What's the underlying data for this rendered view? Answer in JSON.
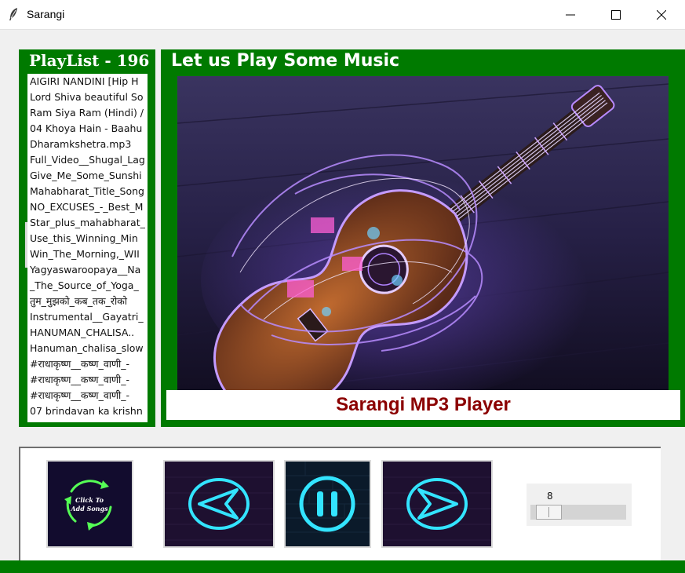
{
  "window": {
    "title": "Sarangi",
    "app_icon": "feather-icon",
    "controls": [
      "minimize-icon",
      "maximize-icon",
      "close-icon"
    ]
  },
  "playlist": {
    "title": "PlayList - 196",
    "items": [
      "AIGIRI NANDINI [Hip H",
      "Lord Shiva beautiful So",
      "Ram Siya Ram (Hindi) /",
      "04 Khoya Hain - Baahu",
      "Dharamkshetra.mp3",
      "Full_Video__Shugal_Lag",
      "Give_Me_Some_Sunshi",
      "Mahabharat_Title_Song",
      "NO_EXCUSES_-_Best_M",
      "Star_plus_mahabharat_",
      "Use_this_Winning_Min",
      "Win_The_Morning,_WII",
      "Yagyaswaroopaya__Na",
      "_The_Source_of_Yoga_",
      "तुम_मुझको_कब_तक_रोको",
      "Instrumental__Gayatri_",
      "HANUMAN_CHALISA..",
      "Hanuman_chalisa_slow",
      "#राधाकृष्ण__कष्ण_वाणी_-",
      "#राधाकृष्ण__कष्ण_वाणी_-",
      "#राधाकृष्ण__कष्ण_वाणी_-",
      "07  brindavan ka krishn"
    ]
  },
  "player": {
    "title": "Let us Play Some Music",
    "label": "Sarangi MP3 Player",
    "artwork": "glowing-guitar-image"
  },
  "controls": {
    "add_songs_text_line1": "Click To",
    "add_songs_text_line2": "Add Songs",
    "buttons": [
      "add-songs-icon",
      "previous-icon",
      "pause-icon",
      "next-icon"
    ],
    "volume": 8,
    "volume_max": 100
  },
  "colors": {
    "frame_green": "#007a00",
    "label_red": "#8b0000",
    "neon_cyan": "#33e4ff",
    "neon_green": "#55ff55"
  }
}
